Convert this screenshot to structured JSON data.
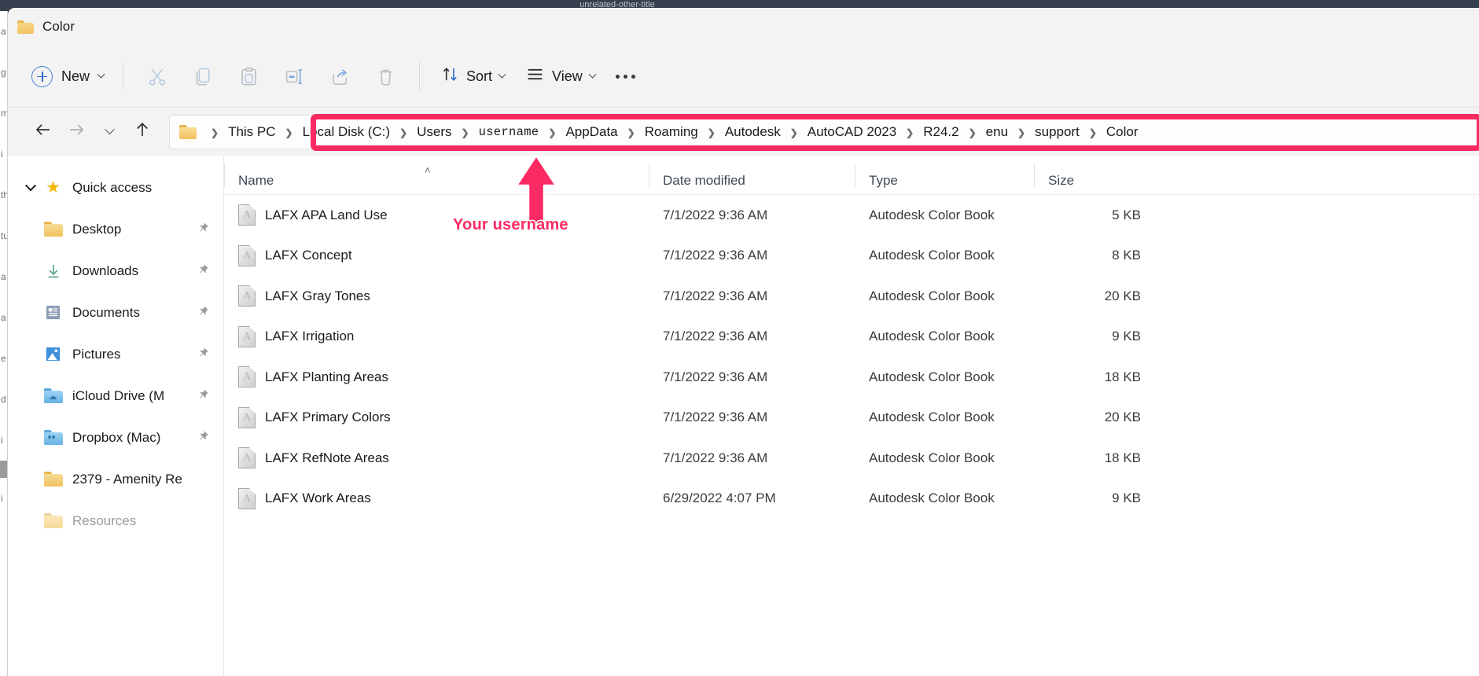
{
  "desktop": {
    "ghost_title": "unrelated-other-title"
  },
  "window": {
    "title": "Color",
    "folder_icon": "folder-icon"
  },
  "toolbar": {
    "new_label": "New",
    "new_icon": "plus-circle-icon",
    "new_chevron": "chevron-down-icon",
    "cut_icon": "scissors-icon",
    "copy_icon": "copy-icon",
    "paste_icon": "clipboard-paste-icon",
    "rename_icon": "rename-icon",
    "share_icon": "share-icon",
    "delete_icon": "trash-icon",
    "sort_label": "Sort",
    "sort_icon": "sort-arrows-icon",
    "view_label": "View",
    "view_icon": "view-lines-icon",
    "more_icon": "ellipsis-icon"
  },
  "nav": {
    "back_icon": "arrow-left-icon",
    "forward_icon": "arrow-right-icon",
    "recent_icon": "chevron-down-icon",
    "up_icon": "arrow-up-icon",
    "address_folder_icon": "folder-icon",
    "breadcrumbs": [
      "This PC",
      "Local Disk (C:)",
      "Users",
      "username",
      "AppData",
      "Roaming",
      "Autodesk",
      "AutoCAD 2023",
      "R24.2",
      "enu",
      "support",
      "Color"
    ],
    "highlight_color": "#fb2a63",
    "highlight_start_crumb": "Local Disk (C:)"
  },
  "annotation": {
    "caption": "Your username",
    "color": "#fb2a63",
    "arrow_icon": "up-arrow-annotation"
  },
  "sidebar": {
    "header": {
      "label": "Quick access",
      "icon": "star-icon",
      "twisty": "chevron-down-icon"
    },
    "items": [
      {
        "label": "Desktop",
        "icon": "folder-icon",
        "pinned": true
      },
      {
        "label": "Downloads",
        "icon": "download-icon",
        "pinned": true
      },
      {
        "label": "Documents",
        "icon": "documents-icon",
        "pinned": true
      },
      {
        "label": "Pictures",
        "icon": "pictures-icon",
        "pinned": true
      },
      {
        "label": "iCloud Drive (M",
        "icon": "icloud-folder-icon",
        "pinned": true
      },
      {
        "label": "Dropbox (Mac)",
        "icon": "dropbox-folder-icon",
        "pinned": true
      },
      {
        "label": "2379 - Amenity Re",
        "icon": "folder-icon",
        "pinned": false
      },
      {
        "label": "Resources",
        "icon": "folder-icon-pale",
        "pinned": false
      }
    ]
  },
  "filelist": {
    "columns": [
      "Name",
      "Date modified",
      "Type",
      "Size"
    ],
    "sort_indicator": "ascending-caret",
    "rows": [
      {
        "name": "LAFX APA Land Use",
        "date": "7/1/2022 9:36 AM",
        "type": "Autodesk Color Book",
        "size": "5 KB",
        "icon": "autodesk-color-book-icon"
      },
      {
        "name": "LAFX Concept",
        "date": "7/1/2022 9:36 AM",
        "type": "Autodesk Color Book",
        "size": "8 KB",
        "icon": "autodesk-color-book-icon"
      },
      {
        "name": "LAFX Gray Tones",
        "date": "7/1/2022 9:36 AM",
        "type": "Autodesk Color Book",
        "size": "20 KB",
        "icon": "autodesk-color-book-icon"
      },
      {
        "name": "LAFX Irrigation",
        "date": "7/1/2022 9:36 AM",
        "type": "Autodesk Color Book",
        "size": "9 KB",
        "icon": "autodesk-color-book-icon"
      },
      {
        "name": "LAFX Planting Areas",
        "date": "7/1/2022 9:36 AM",
        "type": "Autodesk Color Book",
        "size": "18 KB",
        "icon": "autodesk-color-book-icon"
      },
      {
        "name": "LAFX Primary Colors",
        "date": "7/1/2022 9:36 AM",
        "type": "Autodesk Color Book",
        "size": "20 KB",
        "icon": "autodesk-color-book-icon"
      },
      {
        "name": "LAFX RefNote Areas",
        "date": "7/1/2022 9:36 AM",
        "type": "Autodesk Color Book",
        "size": "18 KB",
        "icon": "autodesk-color-book-icon"
      },
      {
        "name": "LAFX Work Areas",
        "date": "6/29/2022 4:07 PM",
        "type": "Autodesk Color Book",
        "size": "9 KB",
        "icon": "autodesk-color-book-icon"
      }
    ]
  }
}
